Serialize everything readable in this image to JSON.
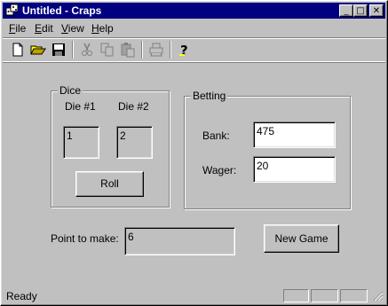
{
  "window": {
    "title": "Untitled - Craps"
  },
  "title_buttons": {
    "minimize": "_",
    "maximize": "□",
    "close": "✕"
  },
  "menu": [
    {
      "label": "File",
      "key": "F",
      "rest": "ile"
    },
    {
      "label": "Edit",
      "key": "E",
      "rest": "dit"
    },
    {
      "label": "View",
      "key": "V",
      "rest": "iew"
    },
    {
      "label": "Help",
      "key": "H",
      "rest": "elp"
    }
  ],
  "toolbar": {
    "icons": [
      "new-file-icon",
      "open-folder-icon",
      "save-icon",
      "cut-icon",
      "copy-icon",
      "paste-icon",
      "print-icon",
      "help-icon"
    ]
  },
  "dice": {
    "group_title": "Dice",
    "die1_label": "Die #1",
    "die2_label": "Die #2",
    "die1_value": "1",
    "die2_value": "2",
    "roll_label": "Roll"
  },
  "betting": {
    "group_title": "Betting",
    "bank_label": "Bank:",
    "bank_value": "475",
    "wager_label": "Wager:",
    "wager_value": "20"
  },
  "point": {
    "label": "Point to make:",
    "value": "6"
  },
  "new_game_label": "New Game",
  "status": {
    "text": "Ready"
  },
  "colors": {
    "titlebar": "#000080",
    "face": "#c0c0c0"
  }
}
